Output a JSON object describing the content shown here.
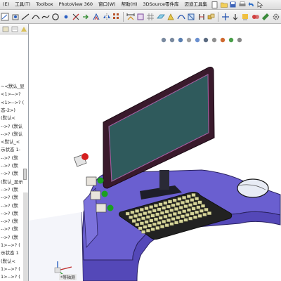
{
  "menubar": {
    "items": [
      "(E)",
      "工具(T)",
      "Toolbox",
      "PhotoView 360",
      "窗口(W)",
      "帮助(H)",
      "3DSource零件库",
      "迈迪工具集"
    ],
    "accent": "#3a6fc4"
  },
  "toolbar": {
    "buttons": [
      "document-icon",
      "open-folder-icon",
      "save-icon",
      "print-icon",
      "undo-icon",
      "redo-icon",
      "sketch-icon",
      "arc-icon",
      "circle-icon",
      "spline-icon",
      "smart-dimension-icon",
      "plane-icon",
      "mate-icon",
      "explode-icon",
      "assembly-icon",
      "options-icon"
    ]
  },
  "left_panel": {
    "tree_rows": [
      "~<默认_显",
      "<1>-->?",
      "<1>-->? (",
      "态-2>)",
      "(默认<",
      "-->? (默认",
      "-->? (默认",
      "<默认_<",
      "示状态 1-",
      "-->? (默",
      "-->? (默",
      "-->? (默",
      "(默认_显示",
      "-->? (默",
      "-->? (默",
      "-->? (默",
      "-->? (默",
      "-->? (默",
      "-->? (默",
      "-->? (默",
      "1>-->? (",
      "示状态 1",
      "(默认<",
      "1>-->? (",
      "1>-->? ("
    ]
  },
  "viewport": {
    "heads_up_icons": [
      "zoom-to-fit-icon",
      "zoom-area-icon",
      "previous-view-icon",
      "section-view-icon",
      "view-orientation-icon",
      "display-style-icon",
      "hide-show-icon",
      "edit-appearance-icon",
      "apply-scene-icon",
      "view-settings-icon"
    ],
    "triad_label": "*等轴测",
    "colors": {
      "desk": "#6a5fd0",
      "monitor_frame": "#3a1a2c",
      "screen": "#2f5a5c",
      "keyboard": "#d6d59b",
      "button_red": "#d52020",
      "button_green": "#1aa020",
      "mouse": "#e8ecf5"
    }
  }
}
